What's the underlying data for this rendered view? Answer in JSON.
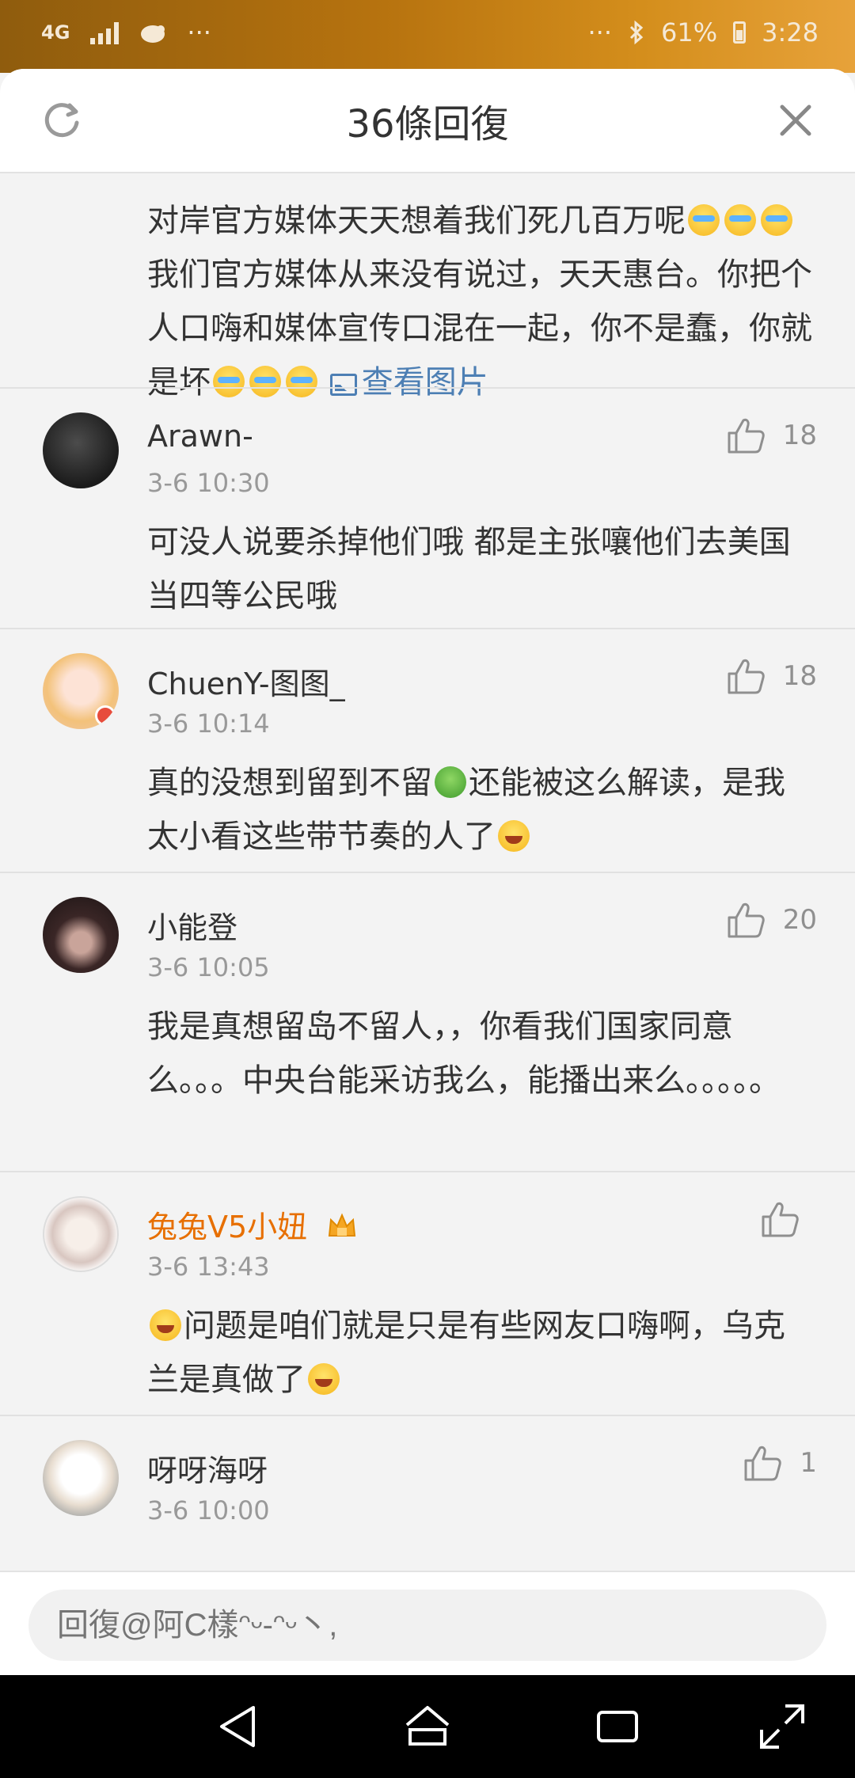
{
  "status_bar": {
    "network": "4G",
    "left_more": "···",
    "right_more": "···",
    "battery": "61%",
    "time": "3:28"
  },
  "header": {
    "title": "36條回復",
    "icons": [
      "refresh-icon",
      "close-icon"
    ]
  },
  "top_comment": {
    "text_1": "对岸官方媒体天天想着我们死几百万呢",
    "text_2": "我们官方媒体从来没有说过，天天惠台。你把个人口嗨和媒体宣传口混在一起，你不是蠢，你就是坏",
    "link": "查看图片"
  },
  "comments": [
    {
      "name": "Arawn-",
      "time": "3-6 10:30",
      "likes": "18",
      "text": "可没人说要杀掉他们哦 都是主张嚷他们去美国当四等公民哦"
    },
    {
      "name": "ChuenY-图图_",
      "time": "3-6 10:14",
      "likes": "18",
      "text_1": "真的没想到留到不留",
      "text_2": "还能被这么解读，是我太小看这些带节奏的人了"
    },
    {
      "name": "小能登",
      "time": "3-6 10:05",
      "likes": "20",
      "text": "我是真想留岛不留人，，你看我们国家同意么。。。中央台能采访我么，能播出来么。。。。。"
    },
    {
      "name": "兔兔V5小妞",
      "time": "3-6 13:43",
      "likes": "",
      "text": "问题是咱们就是只是有些网友口嗨啊，乌克兰是真做了"
    },
    {
      "name": "呀呀海呀",
      "time": "3-6 10:00",
      "likes": "1",
      "text": ""
    }
  ],
  "reply": {
    "placeholder": "回復@阿C樣ᵔᵕ-ᵔᵕ丶,"
  },
  "colors": {
    "vip_name": "#e76f00",
    "link": "#4d7fb4",
    "status_gradient_start": "#8f5c0d",
    "status_gradient_end": "#e7a23a"
  }
}
